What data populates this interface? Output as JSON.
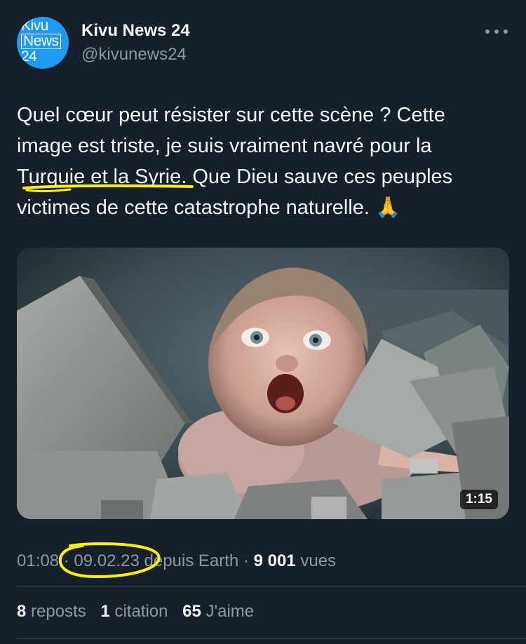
{
  "author": {
    "avatar_text": [
      "Kivu",
      "News",
      "24"
    ],
    "display_name": "Kivu News 24",
    "handle": "@kivunews24"
  },
  "tweet": {
    "text_before": "Quel cœur peut résister sur cette scène ? Cette image est triste, je suis vraiment navré pour la ",
    "text_highlight": "Turquie et la Syrie",
    "text_after": ". Que Dieu sauve ces peuples victimes de cette catastrophe naturelle. 🙏"
  },
  "media": {
    "duration": "1:15"
  },
  "meta": {
    "time": "01:08",
    "date": "09.02.23",
    "source": "depuis Earth",
    "views_count": "9 001",
    "views_label": "vues"
  },
  "stats": {
    "reposts_count": "8",
    "reposts_label": "reposts",
    "quotes_count": "1",
    "quotes_label": "citation",
    "likes_count": "65",
    "likes_label": "J'aime"
  },
  "colors": {
    "background": "#15202b",
    "text": "#f7f9f9",
    "secondary": "#8b98a5",
    "annotation": "#fff200",
    "avatar": "#1d9bf0"
  }
}
